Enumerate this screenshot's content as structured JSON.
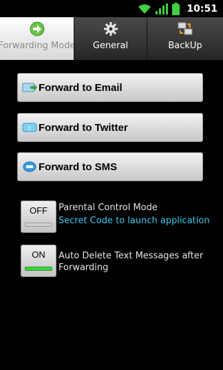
{
  "status_bar": {
    "time": "10:51",
    "icons": [
      "wifi-icon",
      "signal-icon",
      "battery-icon"
    ]
  },
  "tabs": [
    {
      "label": "Forwarding Mode",
      "icon": "forward-arrow-icon",
      "active": true
    },
    {
      "label": "General",
      "icon": "gear-icon",
      "active": false
    },
    {
      "label": "BackUp",
      "icon": "backup-icon",
      "active": false
    }
  ],
  "buttons": {
    "email_label": "Forward to Email",
    "twitter_label": "Forward to Twitter",
    "sms_label": "Forward to SMS"
  },
  "toggles": {
    "parental": {
      "state": "OFF",
      "title": "Parental Control Mode",
      "subtitle": "Secret Code to launch application"
    },
    "auto_delete": {
      "state": "ON",
      "title": "Auto Delete Text Messages after Forwarding"
    }
  },
  "colors": {
    "background": "#000000",
    "accent_link": "#3cc8f0",
    "toggle_on": "#3fd13f",
    "toggle_off": "#d0d0d0"
  }
}
